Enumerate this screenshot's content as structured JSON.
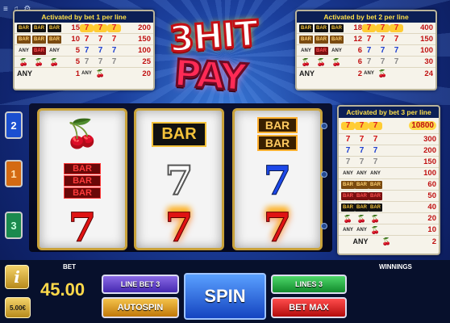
{
  "topbar": {
    "menu_icon": "≡",
    "sound_icon": "♫",
    "settings_icon": "⚙"
  },
  "logo": {
    "line1": "3HIT",
    "line2": "PAY"
  },
  "paytable_bet1": {
    "title": "Activated by bet 1 per line",
    "rows": [
      {
        "symbols": [
          "bar",
          "bar1",
          "bar2"
        ],
        "mid": "15",
        "right": "200"
      },
      {
        "symbols": [
          "bar",
          "bar1",
          "bar2"
        ],
        "mid": "10",
        "right": "150"
      },
      {
        "symbols": [
          "any",
          "any",
          "any"
        ],
        "mid": "5",
        "right": "100"
      },
      {
        "symbols": [
          "ch",
          "ch",
          "ch"
        ],
        "mid": "5",
        "right": "25"
      },
      {
        "any_label": "ANY",
        "mid": "1",
        "right": "20"
      }
    ]
  },
  "paytable_bet2": {
    "title": "Activated by bet 2 per line",
    "rows": [
      {
        "mid": "18",
        "right": "400"
      },
      {
        "mid": "12",
        "right": "150"
      },
      {
        "mid": "6",
        "right": "100"
      },
      {
        "mid": "6",
        "right": "30"
      },
      {
        "any_label": "ANY",
        "mid": "2",
        "right": "24"
      }
    ]
  },
  "paytable_bet3": {
    "title": "Activated by bet 3 per line",
    "jackpot": "10800",
    "rows": [
      "300",
      "200",
      "150",
      "100",
      "60",
      "50",
      "40",
      "20",
      "10"
    ],
    "any_label": "ANY",
    "last_value": "2"
  },
  "line_tabs": [
    "2",
    "1",
    "3"
  ],
  "reels": {
    "reel1": {
      "top": "cherry",
      "middle": "BAR",
      "bottom": "7"
    },
    "reel2": {
      "top": "BAR",
      "middle": "7",
      "bottom": "7"
    },
    "reel3": {
      "top": "BAR",
      "middle": "7",
      "bottom": "7"
    }
  },
  "controls": {
    "info_label": "i",
    "coin_value": "5.00€",
    "bet_label": "BET",
    "bet_value": "45.00",
    "line_bet_label": "LINE BET 3",
    "autospin_label": "AUTOSPIN",
    "spin_label": "SPIN",
    "lines_label": "LINES 3",
    "bet_max_label": "BET MAX",
    "winnings_label": "WINNINGS",
    "winnings_value": ""
  },
  "colors": {
    "background": "#1b3f9c",
    "accent_gold": "#ffd94a",
    "seven_red": "#e01313",
    "seven_blue": "#1d48e8"
  }
}
